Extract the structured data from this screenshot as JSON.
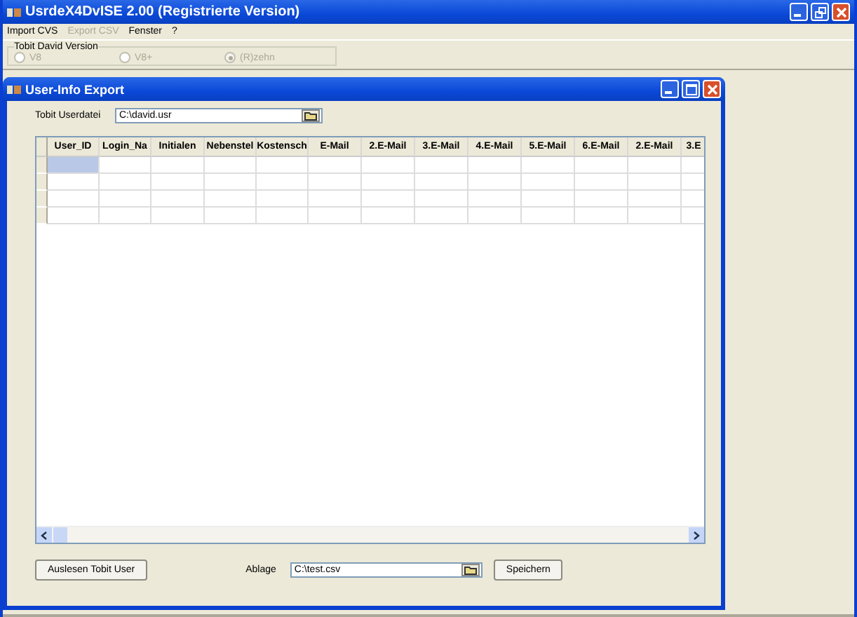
{
  "window": {
    "title": "UsrdeX4DvISE  2.00 (Registrierte Version)"
  },
  "menu": [
    {
      "label": "Import CVS",
      "disabled": false
    },
    {
      "label": "Export CSV",
      "disabled": true
    },
    {
      "label": "Fenster",
      "disabled": false
    },
    {
      "label": "?",
      "disabled": false
    }
  ],
  "version_group": {
    "title": "Tobit David Version",
    "options": [
      {
        "label": "V8",
        "selected": false,
        "disabled": true
      },
      {
        "label": "V8+",
        "selected": false,
        "disabled": true
      },
      {
        "label": "(R)zehn",
        "selected": true,
        "disabled": true
      }
    ]
  },
  "child_window": {
    "title": "User-Info Export",
    "userfile": {
      "label": "Tobit Userdatei",
      "value": "C:\\david.usr"
    },
    "table": {
      "columns": [
        "User_ID",
        "Login_Na",
        "Initialen",
        "Nebenstel",
        "Kostensch",
        "E-Mail",
        "2.E-Mail",
        "3.E-Mail",
        "4.E-Mail",
        "5.E-Mail",
        "6.E-Mail",
        "2.E-Mail",
        "3.E"
      ],
      "rows": [
        {
          "selected": true
        },
        {
          "selected": false
        },
        {
          "selected": false
        },
        {
          "selected": false
        }
      ]
    },
    "read_button": "Auslesen Tobit User",
    "target": {
      "label": "Ablage",
      "value": "C:\\test.csv"
    },
    "save_button": "Speichern"
  }
}
